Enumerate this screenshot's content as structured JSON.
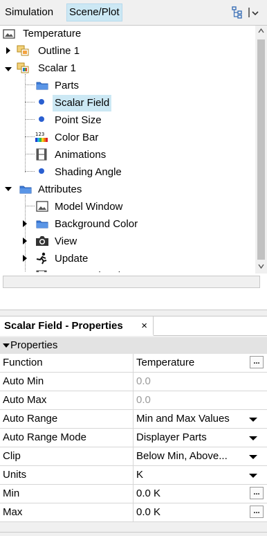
{
  "tabs": {
    "simulation": "Simulation",
    "scene_plot": "Scene/Plot"
  },
  "tree": {
    "root": "Temperature",
    "outline": "Outline 1",
    "scalar": "Scalar 1",
    "parts": "Parts",
    "scalar_field": "Scalar Field",
    "point_size": "Point Size",
    "color_bar": "Color Bar",
    "animations": "Animations",
    "shading_angle": "Shading Angle",
    "attributes": "Attributes",
    "model_window": "Model Window",
    "background_color": "Background Color",
    "view": "View",
    "update": "Update",
    "scene_animation": "Scene animation"
  },
  "properties": {
    "tab_title": "Scalar Field - Properties",
    "close_glyph": "×",
    "section": "Properties",
    "ellipsis": "...",
    "rows": [
      {
        "key": "Function",
        "value": "Temperature"
      },
      {
        "key": "Auto Min",
        "value": "0.0"
      },
      {
        "key": "Auto Max",
        "value": "0.0"
      },
      {
        "key": "Auto Range",
        "value": "Min and Max Values"
      },
      {
        "key": "Auto Range Mode",
        "value": "Displayer Parts"
      },
      {
        "key": "Clip",
        "value": "Below Min, Above..."
      },
      {
        "key": "Units",
        "value": "K"
      },
      {
        "key": "Min",
        "value": "0.0 K"
      },
      {
        "key": "Max",
        "value": "0.0 K"
      }
    ]
  },
  "colors": {
    "selection": "#cce8f4",
    "folder": "#3b7ad8",
    "dot": "#2a5fd0"
  }
}
